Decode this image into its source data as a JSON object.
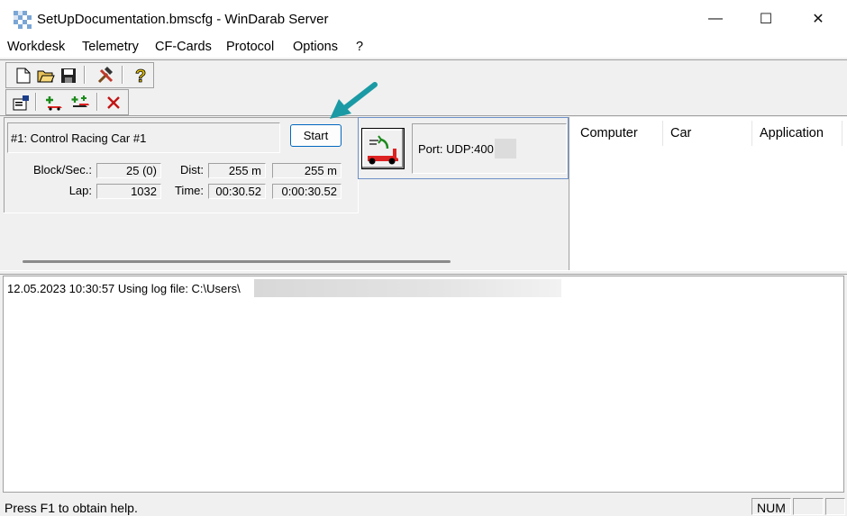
{
  "window": {
    "title": "SetUpDocumentation.bmscfg - WinDarab Server",
    "minimize_label": "—",
    "maximize_label": "☐",
    "close_label": "✕"
  },
  "menu": {
    "items": [
      "Workdesk",
      "Telemetry",
      "CF-Cards",
      "Protocol",
      "Options",
      "?"
    ]
  },
  "toolbar1": {
    "icons": [
      "new-file-icon",
      "open-folder-icon",
      "save-icon",
      "tools-icon",
      "help-icon"
    ]
  },
  "toolbar2": {
    "icons": [
      "properties-icon",
      "add-car-icon",
      "add-multiple-cars-icon",
      "delete-icon"
    ]
  },
  "car_panel": {
    "name": "#1: Control Racing Car #1",
    "start_label": "Start",
    "block_label": "Block/Sec.:",
    "block_value": "25 (0)",
    "dist_label": "Dist:",
    "dist_value1": "255 m",
    "dist_value2": "255 m",
    "lap_label": "Lap:",
    "lap_value": "1032",
    "time_label": "Time:",
    "time_value1": "00:30.52",
    "time_value2": "0:00:30.52"
  },
  "port_panel": {
    "port_text": "Port: UDP:400"
  },
  "connections": {
    "columns": [
      "Computer",
      "Car",
      "Application"
    ]
  },
  "log": {
    "line": "12.05.2023 10:30:57 Using log file: C:\\Users\\"
  },
  "status": {
    "help_text": "Press F1 to obtain help.",
    "num": "NUM"
  },
  "colors": {
    "annotation_arrow": "#1a9aa5",
    "selection_border": "#0067c0"
  }
}
